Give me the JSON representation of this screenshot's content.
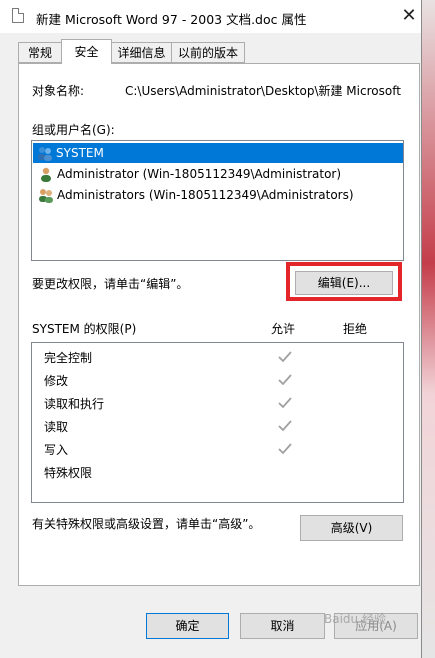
{
  "window": {
    "title": "新建 Microsoft Word 97 - 2003 文档.doc 属性",
    "close": "✕"
  },
  "tabs": [
    {
      "label": "常规"
    },
    {
      "label": "安全"
    },
    {
      "label": "详细信息"
    },
    {
      "label": "以前的版本"
    }
  ],
  "security": {
    "object_name_label": "对象名称:",
    "object_name_value": "C:\\Users\\Administrator\\Desktop\\新建 Microsoft",
    "groups_label": "组或用户名(G):",
    "users": [
      {
        "label": "SYSTEM",
        "icon": "users-group-icon",
        "selected": true
      },
      {
        "label": "Administrator (Win-1805112349\\Administrator)",
        "icon": "user-icon",
        "selected": false
      },
      {
        "label": "Administrators (Win-1805112349\\Administrators)",
        "icon": "users-group-icon",
        "selected": false
      }
    ],
    "change_hint": "要更改权限，请单击“编辑”。",
    "edit_button": "编辑(E)...",
    "permissions_label": "SYSTEM 的权限(P)",
    "allow_header": "允许",
    "deny_header": "拒绝",
    "permissions": [
      {
        "name": "完全控制",
        "allow": true
      },
      {
        "name": "修改",
        "allow": true
      },
      {
        "name": "读取和执行",
        "allow": true
      },
      {
        "name": "读取",
        "allow": true
      },
      {
        "name": "写入",
        "allow": true
      },
      {
        "name": "特殊权限",
        "allow": false
      }
    ],
    "advanced_hint": "有关特殊权限或高级设置，请单击“高级”。",
    "advanced_button": "高级(V)"
  },
  "footer": {
    "ok": "确定",
    "cancel": "取消",
    "apply": "应用(A)"
  },
  "watermark": "Baidu 经验",
  "colors": {
    "selection": "#0078d7",
    "highlight_frame": "#e4262b",
    "checkmark": "#a0a0a0"
  }
}
